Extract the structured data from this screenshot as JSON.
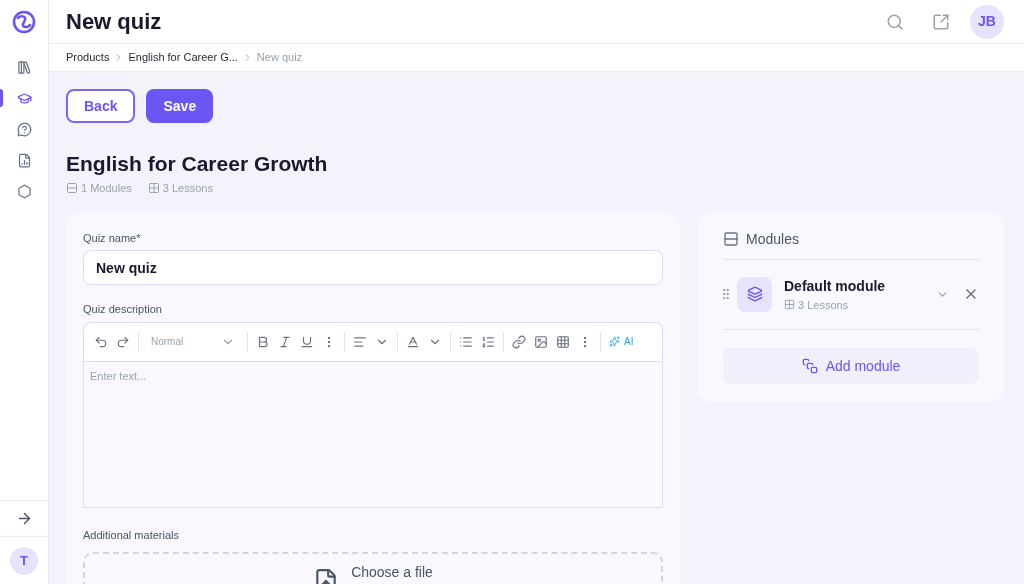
{
  "header": {
    "title": "New quiz",
    "avatar": "JB"
  },
  "sidebar": {
    "items": [
      {
        "kind": "books",
        "selected": false
      },
      {
        "kind": "cap",
        "selected": true
      },
      {
        "kind": "help",
        "selected": false
      },
      {
        "kind": "chart",
        "selected": false
      },
      {
        "kind": "settings",
        "selected": false
      }
    ],
    "user_avatar": "T"
  },
  "breadcrumb": [
    {
      "label": "Products",
      "current": false
    },
    {
      "label": "English for Career G...",
      "current": false
    },
    {
      "label": "New quiz",
      "current": true
    }
  ],
  "actions": [
    {
      "label": "Back",
      "kind": "outline"
    },
    {
      "label": "Save",
      "kind": "primary"
    }
  ],
  "course": {
    "title": "English for Career Growth",
    "modules": "1 Modules",
    "lessons": "3 Lessons"
  },
  "form": {
    "name_label": "Quiz name*",
    "name_value": "New quiz",
    "description_label": "Quiz description",
    "style_select": "Normal",
    "ai_label": "AI",
    "editor_placeholder": "Enter text...",
    "materials_label": "Additional materials",
    "upload_label": "Choose a file"
  },
  "modules_panel": {
    "title": "Modules",
    "items": [
      {
        "name": "Default module",
        "lessons": "3 Lessons"
      }
    ],
    "add_label": "Add module"
  }
}
